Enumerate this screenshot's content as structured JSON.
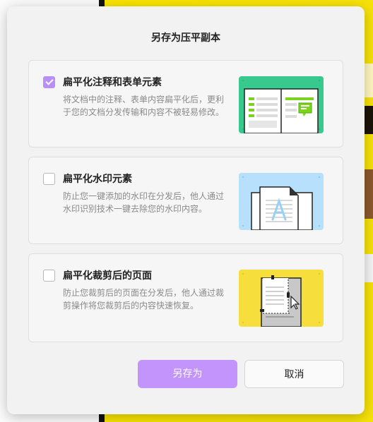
{
  "dialog": {
    "title": "另存为压平副本",
    "options": [
      {
        "label": "扁平化注释和表单元素",
        "description": "将文档中的注释、表单内容扁平化后，更利于您的文档分发传输和内容不被轻易修改。",
        "checked": true,
        "illustration": "flatten-annotations-illustration",
        "color": "#37c98e"
      },
      {
        "label": "扁平化水印元素",
        "description": "防止您一键添加的水印在分发后，他人通过水印识别技术一键去除您的水印内容。",
        "checked": false,
        "illustration": "flatten-watermark-illustration",
        "color": "#b6e0fb"
      },
      {
        "label": "扁平化裁剪后的页面",
        "description": "防止您裁剪后的页面在分发后，他人通过裁剪操作将您裁剪后的内容快速恢复。",
        "checked": false,
        "illustration": "flatten-crop-illustration",
        "color": "#f6de3c"
      }
    ],
    "buttons": {
      "save_as": "另存为",
      "cancel": "取消"
    },
    "accent_color": "#c394fb"
  }
}
